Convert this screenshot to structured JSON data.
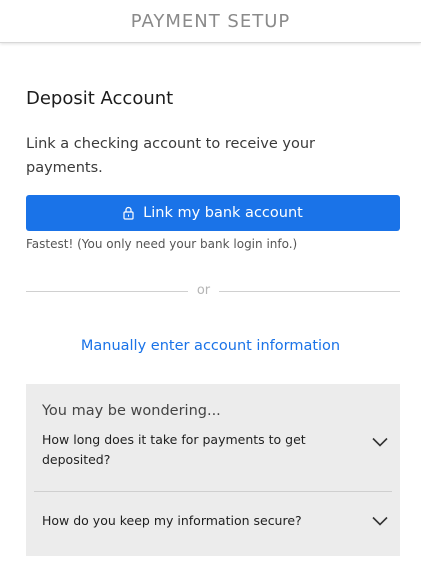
{
  "header": {
    "title": "PAYMENT SETUP"
  },
  "deposit": {
    "title": "Deposit Account",
    "description": "Link a checking account to receive your payments.",
    "link_button": "Link my bank account",
    "hint": "Fastest! (You only need your bank login info.)",
    "or": "or",
    "manual_link": "Manually enter account information"
  },
  "faq": {
    "heading": "You may be wondering...",
    "items": [
      {
        "question": "How long does it take for payments to get deposited?",
        "icon": "chevron-down-icon"
      },
      {
        "question": "How do you keep my information secure?",
        "icon": "chevron-down-icon"
      }
    ]
  },
  "colors": {
    "accent": "#1a73e8",
    "faq_background": "#ececec",
    "header_text": "#8a8a8a"
  },
  "icons": {
    "link_button": "lock-icon"
  }
}
